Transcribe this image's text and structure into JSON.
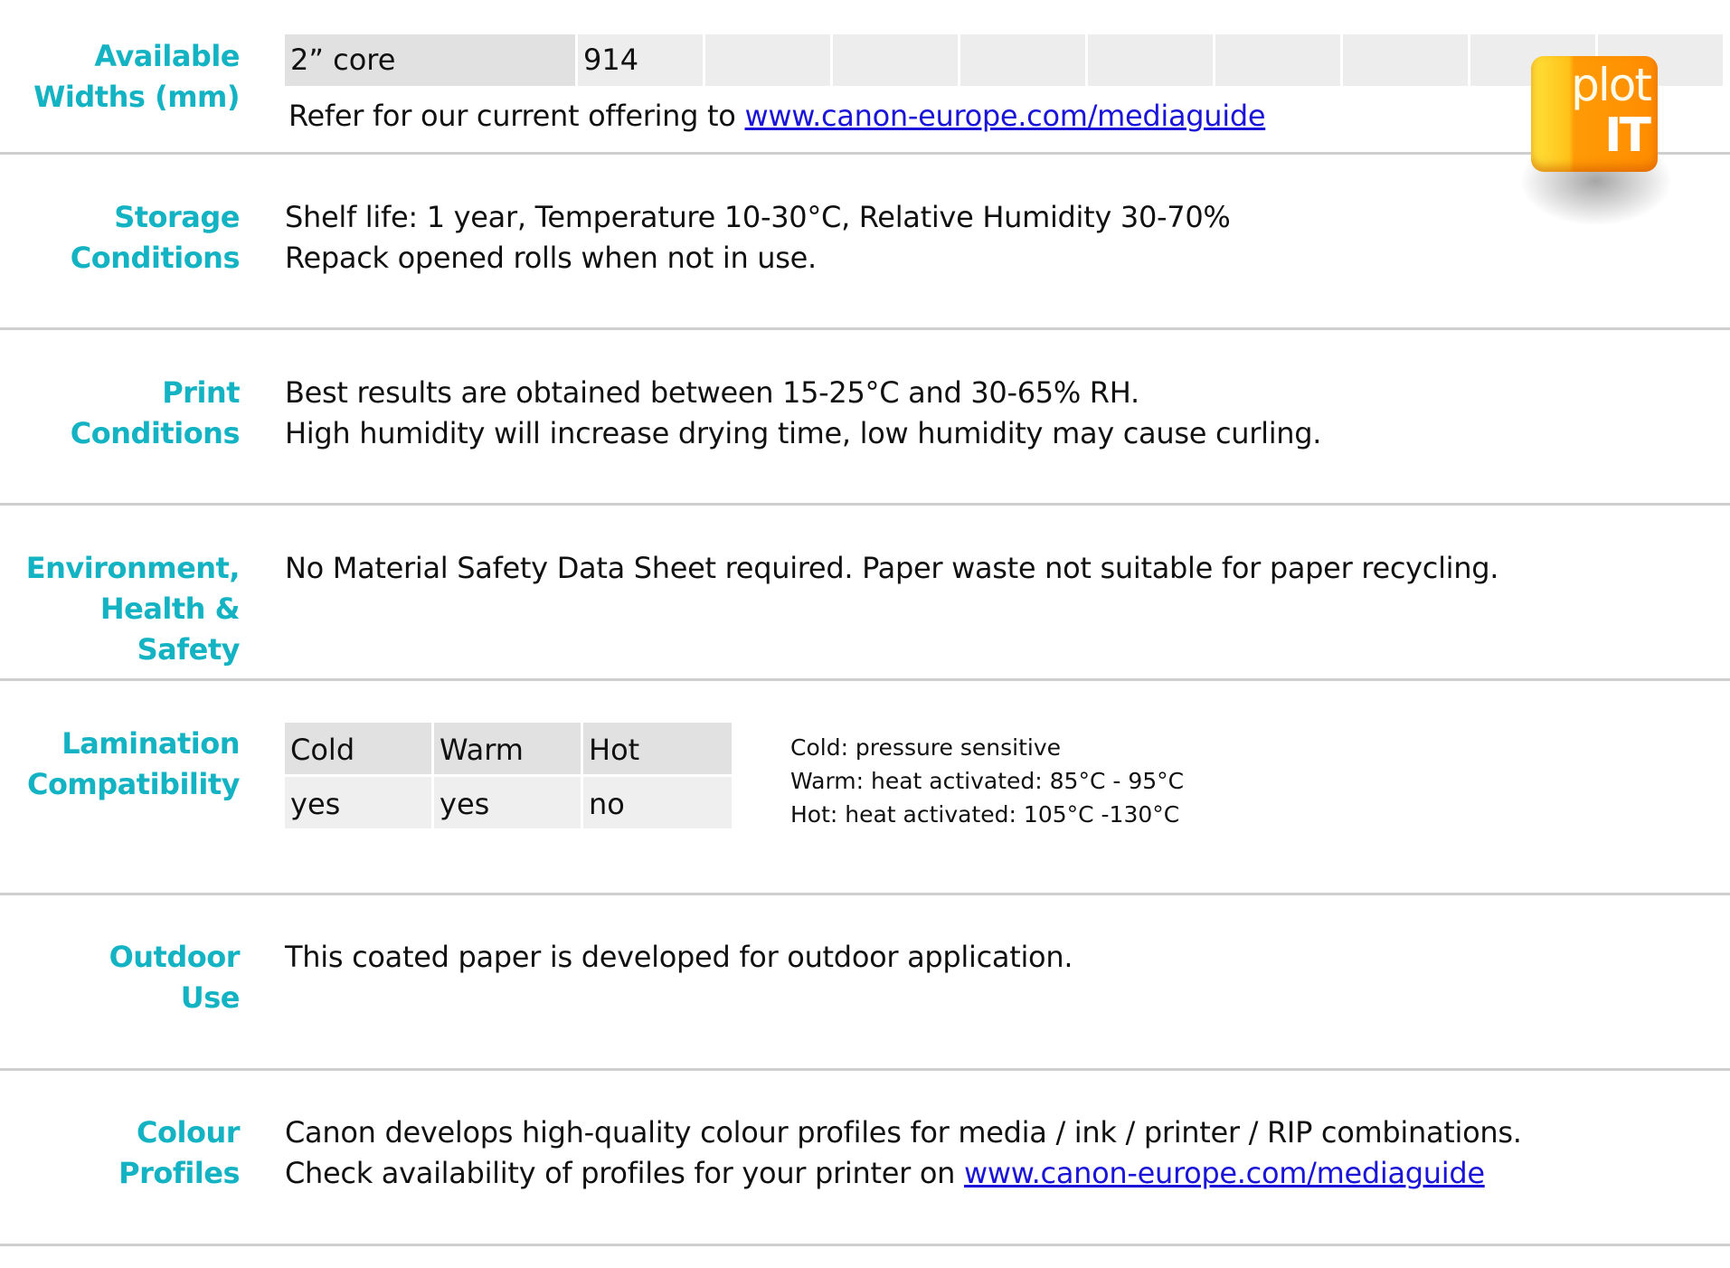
{
  "sections": {
    "widths": {
      "label_lines": [
        "Available",
        "Widths (mm)"
      ],
      "table": {
        "header": "2” core",
        "values": [
          "914",
          "",
          "",
          "",
          "",
          "",
          "",
          "",
          "",
          ""
        ]
      },
      "note_prefix": "Refer for our current offering to ",
      "note_link": "www.canon-europe.com/mediaguide"
    },
    "storage": {
      "label_lines": [
        "Storage",
        "Conditions"
      ],
      "lines": [
        "Shelf life: 1 year, Temperature 10-30°C, Relative Humidity 30-70%",
        "Repack opened rolls when not in use."
      ]
    },
    "print": {
      "label_lines": [
        "Print",
        "Conditions"
      ],
      "lines": [
        "Best results are obtained between 15-25°C and 30-65% RH.",
        "High humidity will increase drying time, low humidity may cause curling."
      ]
    },
    "environment": {
      "label_lines": [
        "Environment,",
        "Health & Safety"
      ],
      "lines": [
        "No Material Safety Data Sheet required. Paper waste not suitable for paper recycling."
      ]
    },
    "lamination": {
      "label_lines": [
        "Lamination",
        "Compatibility"
      ],
      "table": {
        "headers": [
          "Cold",
          "Warm",
          "Hot"
        ],
        "values": [
          "yes",
          "yes",
          "no"
        ]
      },
      "notes": [
        "Cold: pressure sensitive",
        "Warm: heat activated: 85°C - 95°C",
        "Hot: heat activated: 105°C -130°C"
      ]
    },
    "outdoor": {
      "label_lines": [
        "Outdoor",
        "Use"
      ],
      "lines": [
        "This coated paper is developed for outdoor application."
      ]
    },
    "colour": {
      "label_lines": [
        "Colour",
        "Profiles"
      ],
      "line1": "Canon develops high-quality colour profiles for media / ink / printer / RIP combinations.",
      "line2_prefix": "Check availability of profiles for your printer on ",
      "line2_link": "www.canon-europe.com/mediaguide"
    }
  },
  "logo": {
    "line1": "plot",
    "line2": "IT"
  },
  "colors": {
    "label": "#14b3c3",
    "link": "#1a14d9",
    "table_header": "#e1e1e1",
    "table_cell": "#ededed",
    "logo_orange": "#ff8c00",
    "logo_yellow": "#ffe23a"
  }
}
